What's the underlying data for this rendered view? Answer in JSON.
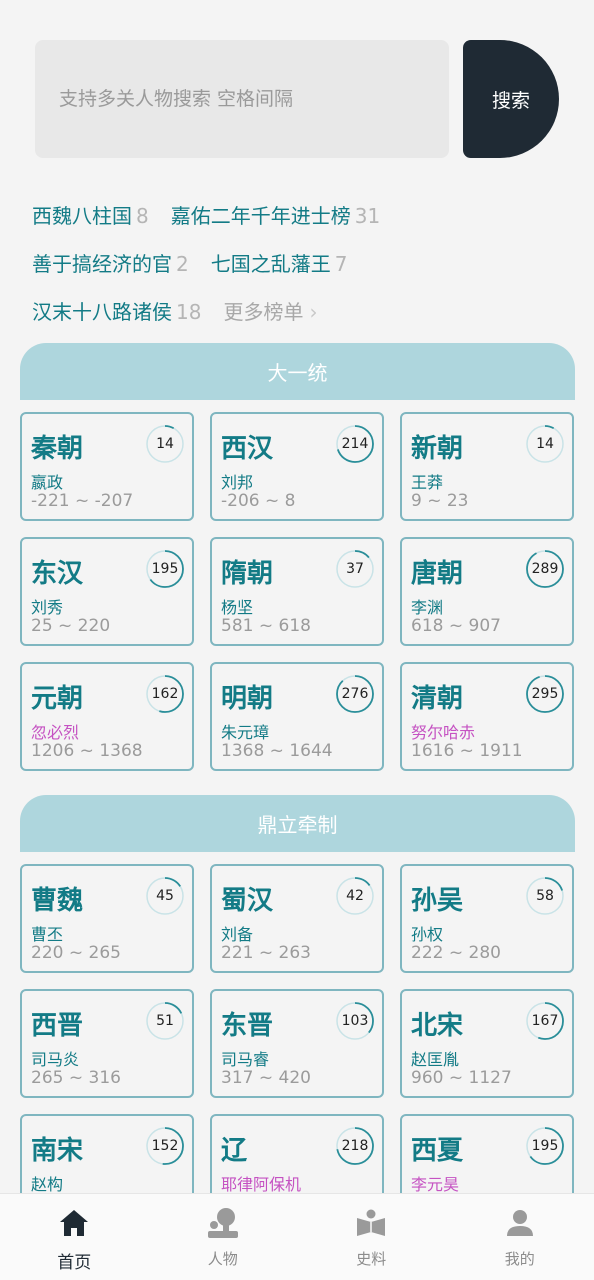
{
  "search": {
    "placeholder": "支持多关人物搜索 空格间隔",
    "button_label": "搜索"
  },
  "tags": [
    [
      {
        "label": "西魏八柱国",
        "count": "8"
      },
      {
        "label": "嘉佑二年千年进士榜",
        "count": "31"
      }
    ],
    [
      {
        "label": "善于搞经济的官",
        "count": "2"
      },
      {
        "label": "七国之乱藩王",
        "count": "7"
      }
    ],
    [
      {
        "label": "汉末十八路诸侯",
        "count": "18"
      }
    ]
  ],
  "more_label": "更多榜单",
  "colors": {
    "accent": "#137b86",
    "ring": "#2a8e99",
    "ring_track": "#c9e3e7",
    "alt_founder": "#c552c2"
  },
  "sections": [
    {
      "title": "大一统",
      "cards": [
        {
          "name": "秦朝",
          "founder": "嬴政",
          "years": "-221 ~ -207",
          "count": "14",
          "progress": 0.08
        },
        {
          "name": "西汉",
          "founder": "刘邦",
          "years": "-206 ~ 8",
          "count": "214",
          "progress": 0.7
        },
        {
          "name": "新朝",
          "founder": "王莽",
          "years": "9 ~ 23",
          "count": "14",
          "progress": 0.08
        },
        {
          "name": "东汉",
          "founder": "刘秀",
          "years": "25 ~ 220",
          "count": "195",
          "progress": 0.65
        },
        {
          "name": "隋朝",
          "founder": "杨坚",
          "years": "581 ~ 618",
          "count": "37",
          "progress": 0.14
        },
        {
          "name": "唐朝",
          "founder": "李渊",
          "years": "618 ~ 907",
          "count": "289",
          "progress": 0.92
        },
        {
          "name": "元朝",
          "founder": "忽必烈",
          "years": "1206 ~ 1368",
          "count": "162",
          "progress": 0.55,
          "alt": true
        },
        {
          "name": "明朝",
          "founder": "朱元璋",
          "years": "1368 ~ 1644",
          "count": "276",
          "progress": 0.88
        },
        {
          "name": "清朝",
          "founder": "努尔哈赤",
          "years": "1616 ~ 1911",
          "count": "295",
          "progress": 0.95,
          "alt": true
        }
      ]
    },
    {
      "title": "鼎立牵制",
      "cards": [
        {
          "name": "曹魏",
          "founder": "曹丕",
          "years": "220 ~ 265",
          "count": "45",
          "progress": 0.16
        },
        {
          "name": "蜀汉",
          "founder": "刘备",
          "years": "221 ~ 263",
          "count": "42",
          "progress": 0.15
        },
        {
          "name": "孙吴",
          "founder": "孙权",
          "years": "222 ~ 280",
          "count": "58",
          "progress": 0.2
        },
        {
          "name": "西晋",
          "founder": "司马炎",
          "years": "265 ~ 316",
          "count": "51",
          "progress": 0.18
        },
        {
          "name": "东晋",
          "founder": "司马睿",
          "years": "317 ~ 420",
          "count": "103",
          "progress": 0.36
        },
        {
          "name": "北宋",
          "founder": "赵匡胤",
          "years": "960 ~ 1127",
          "count": "167",
          "progress": 0.56
        },
        {
          "name": "南宋",
          "founder": "赵构",
          "years": "",
          "count": "152",
          "progress": 0.52
        },
        {
          "name": "辽",
          "founder": "耶律阿保机",
          "years": "",
          "count": "218",
          "progress": 0.72,
          "alt": true
        },
        {
          "name": "西夏",
          "founder": "李元昊",
          "years": "",
          "count": "195",
          "progress": 0.65,
          "alt": true
        }
      ]
    }
  ],
  "nav": [
    {
      "label": "首页",
      "icon": "home-icon",
      "active": true
    },
    {
      "label": "人物",
      "icon": "person-icon",
      "active": false
    },
    {
      "label": "史料",
      "icon": "book-icon",
      "active": false
    },
    {
      "label": "我的",
      "icon": "profile-icon",
      "active": false
    }
  ]
}
